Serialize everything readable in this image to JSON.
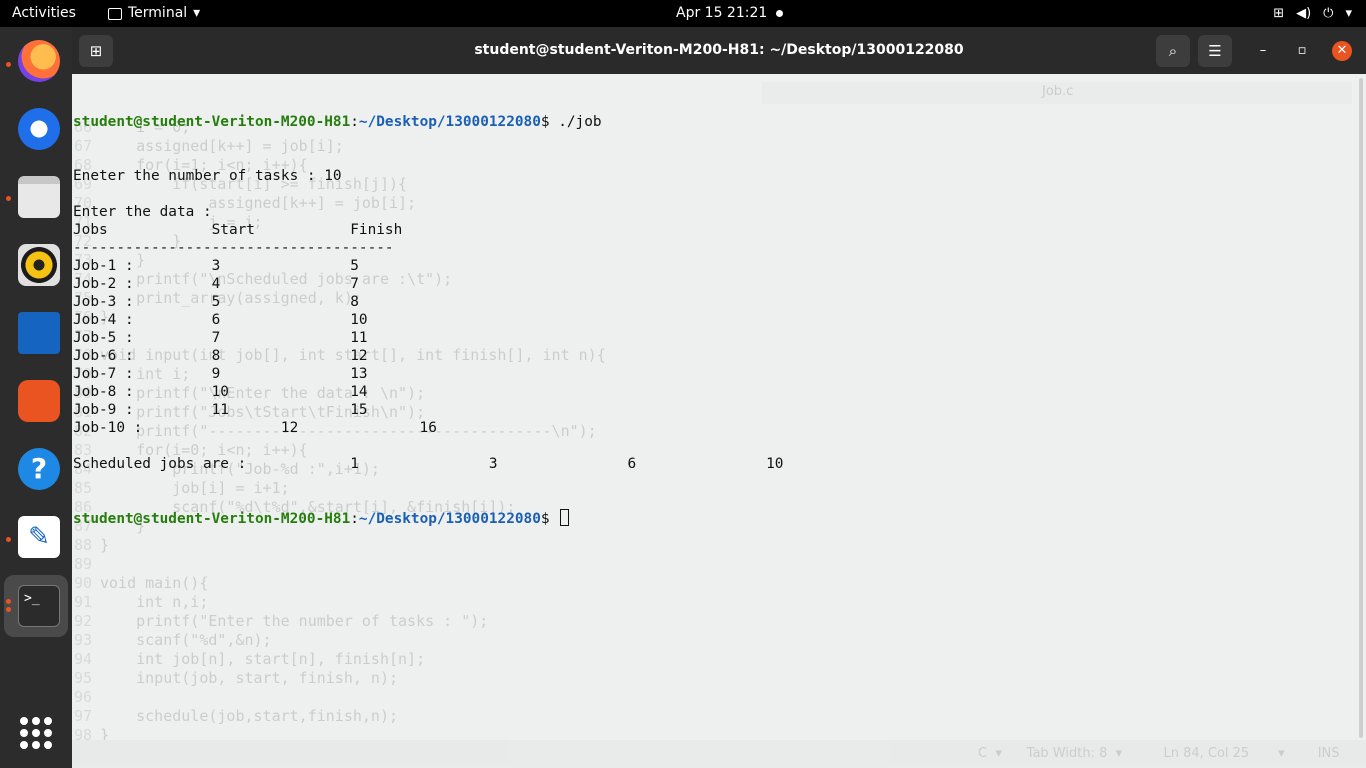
{
  "topbar": {
    "activities": "Activities",
    "app_name": "Terminal",
    "clock": "Apr 15  21:21",
    "tray_icons": [
      "network-icon",
      "volume-icon",
      "power-icon"
    ]
  },
  "dock": {
    "apps": [
      {
        "name": "firefox",
        "running": true
      },
      {
        "name": "thunderbird",
        "running": false
      },
      {
        "name": "files",
        "running": true
      },
      {
        "name": "rhythmbox",
        "running": false
      },
      {
        "name": "libreoffice-writer",
        "running": false
      },
      {
        "name": "ubuntu-software",
        "running": false
      },
      {
        "name": "help",
        "running": false
      },
      {
        "name": "text-editor",
        "running": true
      },
      {
        "name": "terminal",
        "running": true
      }
    ],
    "help_glyph": "?",
    "terminal_glyph": ">_"
  },
  "window": {
    "title": "student@student-Veriton-M200-H81: ~/Desktop/13000122080",
    "close_glyph": "✕",
    "min_glyph": "–",
    "max_glyph": "▫"
  },
  "terminal": {
    "prompt_user": "student@student-Veriton-M200-H81",
    "prompt_path": "~/Desktop/13000122080",
    "command": "./job",
    "lines": [
      "Eneter the number of tasks : 10",
      "",
      "Enter the data :",
      "Jobs\t\tStart\t\tFinish",
      "-------------------------------------",
      "Job-1 :\t\t3\t\t5",
      "Job-2 :\t\t4\t\t7",
      "Job-3 :\t\t5\t\t8",
      "Job-4 :\t\t6\t\t10",
      "Job-5 :\t\t7\t\t11",
      "Job-6 :\t\t8\t\t12",
      "Job-7 :\t\t9\t\t13",
      "Job-8 :\t\t10\t\t14",
      "Job-9 :\t\t11\t\t15",
      "Job-10 :\t\t12\t\t16",
      "",
      "Scheduled jobs are :\t\t1\t\t3\t\t6\t\t10"
    ]
  },
  "ghost_editor": {
    "tab": "Job.c",
    "status": "C  ▾      Tab Width: 8  ▾          Ln 84, Col 25       ▾        INS",
    "gutter": "66\n67\n68\n69\n70\n71\n72\n73\n74\n75\n76\n77\n78\n79\n80\n81\n82\n83\n84\n85\n86\n87\n88\n89\n90\n91\n92\n93\n94\n95\n96\n97\n98",
    "code": "    i = 0;\n    assigned[k++] = job[i];\n    for(i=1; i<n; i++){\n        if(start[i] >= finish[j]){\n            assigned[k++] = job[i];\n            j = i;\n        }\n    }\n    printf(\"\\nScheduled jobs are :\\t\");\n    print_array(assigned, k);\n}\n\nvoid input(int job[], int start[], int finish[], int n){\n    int i;\n    printf(\"\\nEnter the data : \\n\");\n    printf(\"Jobs\\tStart\\tFinish\\n\");\n    printf(\"--------------------------------------\\n\");\n    for(i=0; i<n; i++){\n        printf(\"Job-%d :\",i+1);\n        job[i] = i+1;\n        scanf(\"%d\\t%d\",&start[i], &finish[i]);\n    }\n}\n\nvoid main(){\n    int n,i;\n    printf(\"Enter the number of tasks : \");\n    scanf(\"%d\",&n);\n    int job[n], start[n], finish[n];\n    input(job, start, finish, n);\n\n    schedule(job,start,finish,n);\n}"
  }
}
